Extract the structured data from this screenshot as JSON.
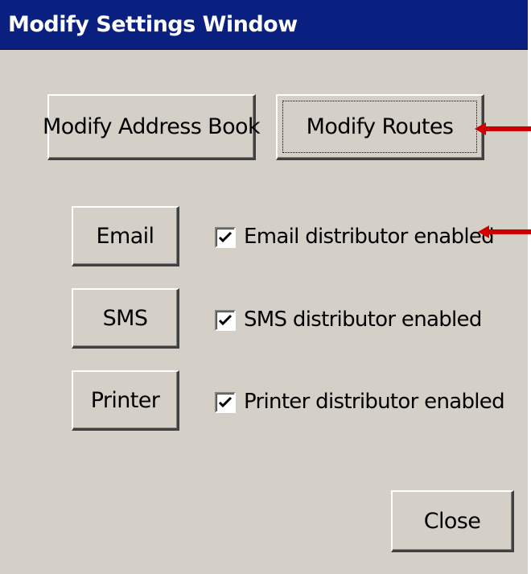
{
  "window": {
    "title": "Modify Settings Window"
  },
  "top_buttons": {
    "address_book_label": "Modify Address Book",
    "routes_label": "Modify Routes"
  },
  "distributors": [
    {
      "button_label": "Email",
      "checkbox_label": "Email distributor enabled",
      "checked": true
    },
    {
      "button_label": "SMS",
      "checkbox_label": "SMS distributor enabled",
      "checked": true
    },
    {
      "button_label": "Printer",
      "checkbox_label": "Printer distributor enabled",
      "checked": true
    }
  ],
  "footer": {
    "close_label": "Close"
  },
  "annotations": {
    "arrow_color": "#cc0000",
    "arrow_icon": "left-arrow-icon"
  },
  "colors": {
    "title_bar": "#0a2080",
    "window_bg": "#d4d0c8"
  }
}
